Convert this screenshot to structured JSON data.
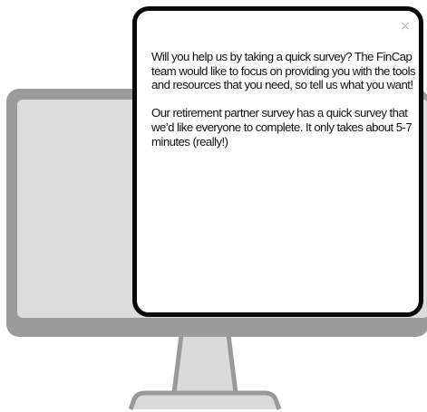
{
  "illustration": {
    "frame_color": "#9b9b9b",
    "screen_color": "#dcdcdc",
    "stand_color": "#dadada",
    "outline_color": "#999999"
  },
  "popup": {
    "close_glyph": "×",
    "close_icon": "close-icon",
    "paragraphs": [
      "Will you help us by taking a quick survey? The FinCap team would like to focus on providing you with the tools and resources that you need, so tell us what you want!",
      "Our retirement partner survey has a quick survey that we’d like everyone to complete. It only takes about 5-7 minutes (really!)"
    ]
  }
}
